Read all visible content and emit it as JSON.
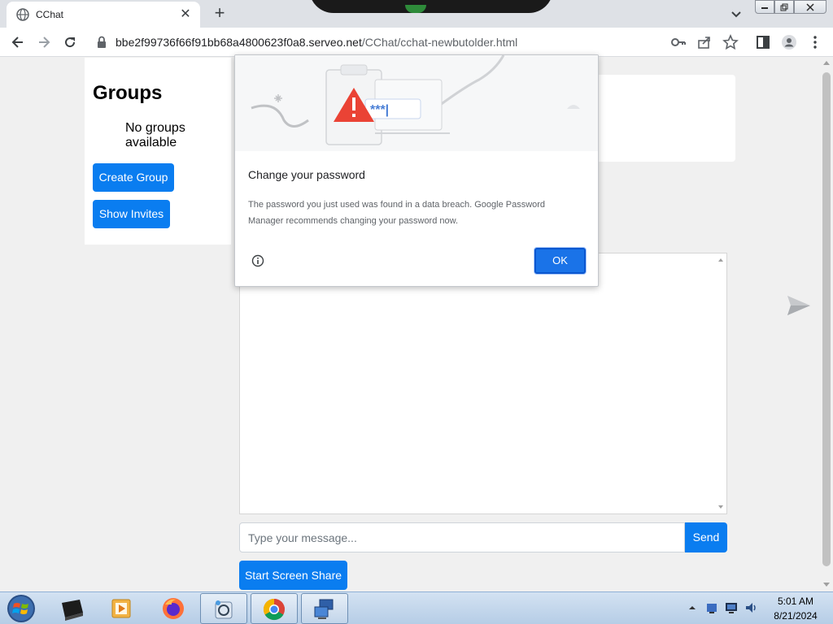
{
  "browser": {
    "tab_title": "CChat",
    "tab_close": "✕",
    "new_tab": "+",
    "url_host": "bbe2f99736f66f91bb68a4800623f0a8.serveo.net",
    "url_path": "/CChat/cchat-newbutolder.html"
  },
  "sidebar": {
    "title": "Groups",
    "empty_text": "No groups available",
    "create_group_label": "Create Group",
    "show_invites_label": "Show Invites"
  },
  "chat": {
    "message_placeholder": "Type your message...",
    "send_label": "Send",
    "screen_share_label": "Start Screen Share"
  },
  "dialog": {
    "title": "Change your password",
    "body": "The password you just used was found in a data breach. Google Password Manager recommends changing your password now.",
    "ok_label": "OK",
    "masked_password": "***|"
  },
  "taskbar": {
    "time": "5:01 AM",
    "date": "8/21/2024"
  },
  "colors": {
    "primary_button": "#0a7df0",
    "dialog_ok": "#1a73e8",
    "warning_red": "#ea4335"
  },
  "icons": [
    "globe-icon",
    "close-icon",
    "plus-icon",
    "back-icon",
    "forward-icon",
    "reload-icon",
    "lock-icon",
    "key-icon",
    "share-icon",
    "star-icon",
    "side-panel-icon",
    "profile-icon",
    "menu-icon",
    "warning-icon",
    "info-icon",
    "send-icon",
    "windows-start-icon",
    "chrome-icon",
    "firefox-icon"
  ]
}
